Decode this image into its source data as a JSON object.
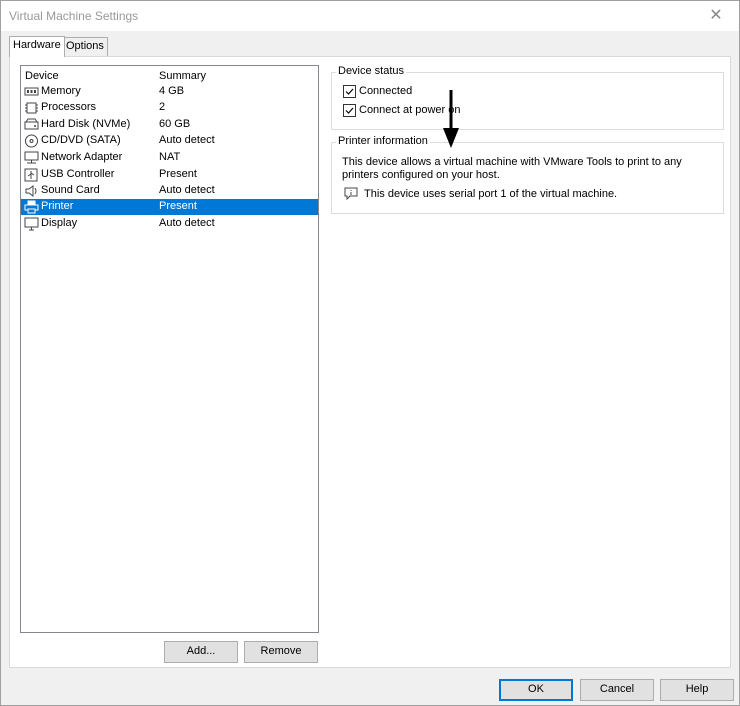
{
  "window": {
    "title": "Virtual Machine Settings",
    "close_glyph": "✕"
  },
  "tabs": [
    {
      "label": "Hardware",
      "active": true
    },
    {
      "label": "Options",
      "active": false
    }
  ],
  "device_list": {
    "headers": {
      "device": "Device",
      "summary": "Summary"
    },
    "rows": [
      {
        "device": "Memory",
        "summary": "4 GB",
        "icon": "memory-icon"
      },
      {
        "device": "Processors",
        "summary": "2",
        "icon": "processor-icon"
      },
      {
        "device": "Hard Disk (NVMe)",
        "summary": "60 GB",
        "icon": "hard-disk-icon"
      },
      {
        "device": "CD/DVD (SATA)",
        "summary": "Auto detect",
        "icon": "cd-dvd-icon"
      },
      {
        "device": "Network Adapter",
        "summary": "NAT",
        "icon": "network-adapter-icon"
      },
      {
        "device": "USB Controller",
        "summary": "Present",
        "icon": "usb-controller-icon"
      },
      {
        "device": "Sound Card",
        "summary": "Auto detect",
        "icon": "sound-card-icon"
      },
      {
        "device": "Printer",
        "summary": "Present",
        "icon": "printer-icon",
        "selected": true
      },
      {
        "device": "Display",
        "summary": "Auto detect",
        "icon": "display-icon"
      }
    ]
  },
  "list_buttons": {
    "add": "Add...",
    "remove": "Remove"
  },
  "device_status": {
    "title": "Device status",
    "connected": {
      "label": "Connected",
      "checked": true
    },
    "connect_at_power_on": {
      "label": "Connect at power on",
      "checked": true
    }
  },
  "printer_info": {
    "title": "Printer information",
    "description_line1": "This device allows a virtual machine with VMware Tools to print to any",
    "description_line2": "printers configured on your host.",
    "note": "This device uses serial port 1 of the virtual machine.",
    "note_icon": "info-comment-icon"
  },
  "dialog_buttons": {
    "ok": "OK",
    "cancel": "Cancel",
    "help": "Help"
  },
  "colors": {
    "selection": "#0078d7",
    "accent": "#0078d7"
  }
}
